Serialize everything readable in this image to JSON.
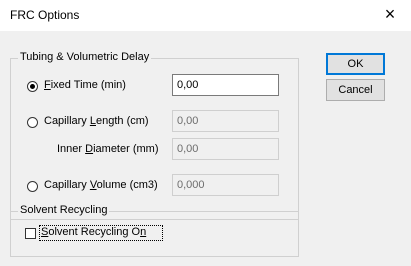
{
  "window": {
    "title": "FRC Options",
    "close_label": "×"
  },
  "tubing_group": {
    "label": "Tubing & Volumetric Delay",
    "fixed_time": {
      "label": "Fixed Time (min)",
      "value": "0,00",
      "selected": true
    },
    "capillary_length": {
      "label": "Capillary Length (cm)",
      "value": "0,00",
      "selected": false
    },
    "inner_diameter": {
      "label": "Inner Diameter (mm)",
      "value": "0,00"
    },
    "capillary_volume": {
      "label": "Capillary Volume (cm3)",
      "value": "0,000",
      "selected": false
    }
  },
  "solvent_group": {
    "label": "Solvent Recycling",
    "checkbox": {
      "label": "Solvent Recycling On",
      "checked": false
    }
  },
  "buttons": {
    "ok": "OK",
    "cancel": "Cancel"
  }
}
